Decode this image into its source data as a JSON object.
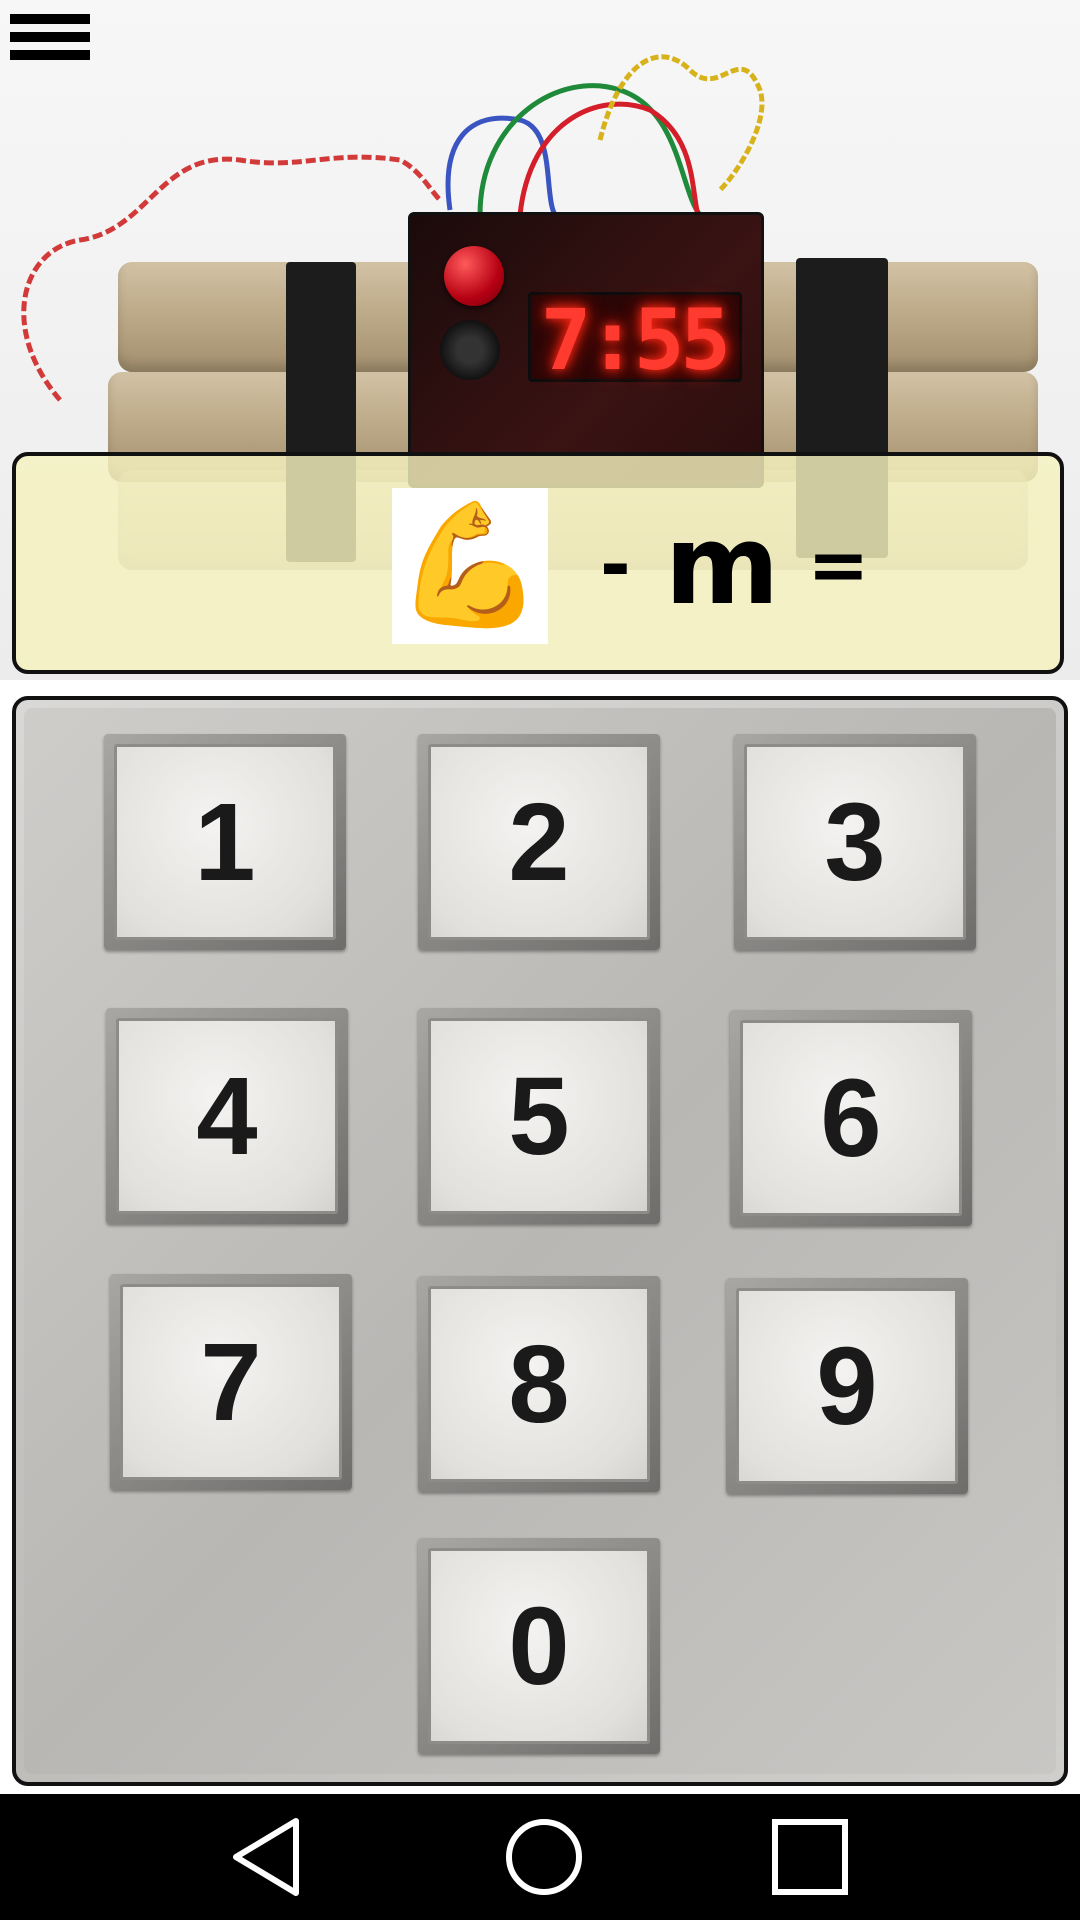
{
  "header": {
    "menu_icon": "hamburger-menu-icon"
  },
  "bomb": {
    "timer_display": "7:55"
  },
  "puzzle": {
    "emoji": "💪",
    "operator_minus": "-",
    "letter": "m",
    "operator_equals": "="
  },
  "keypad": {
    "keys": [
      "1",
      "2",
      "3",
      "4",
      "5",
      "6",
      "7",
      "8",
      "9",
      "0"
    ]
  },
  "nav_bar": {
    "back_icon": "triangle-back-icon",
    "home_icon": "circle-home-icon",
    "recent_icon": "square-recent-apps-icon"
  }
}
